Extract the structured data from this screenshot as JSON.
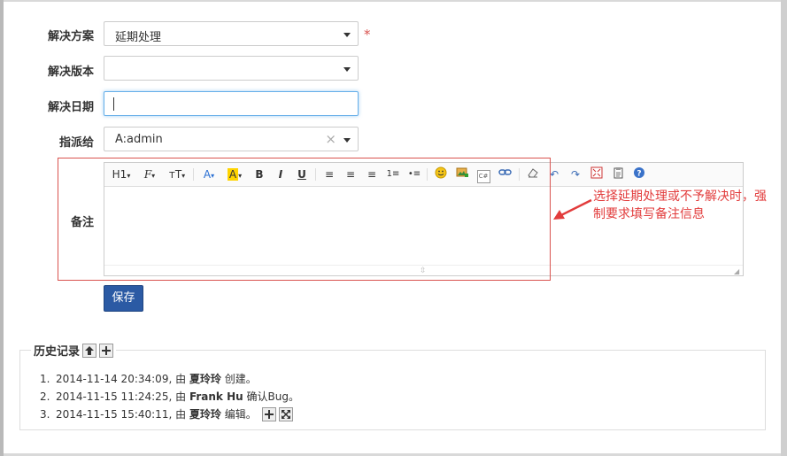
{
  "form": {
    "resolution_label": "解决方案",
    "resolution_value": "延期处理",
    "required_mark": "*",
    "version_label": "解决版本",
    "version_value": "",
    "date_label": "解决日期",
    "date_value": "",
    "assign_label": "指派给",
    "assign_value": "A:admin",
    "assign_clear": "×",
    "note_label": "备注",
    "save_label": "保存"
  },
  "toolbar": [
    "H1",
    "F",
    "тT",
    "A",
    "A",
    "B",
    "I",
    "U",
    "C#"
  ],
  "annotation": {
    "text": "选择延期处理或不予解决时，强制要求填写备注信息"
  },
  "history": {
    "title": "历史记录",
    "items": [
      {
        "num": "1.",
        "time": "2014-11-14 20:34:09,",
        "by": "由",
        "user": "夏玲玲",
        "action": "创建。"
      },
      {
        "num": "2.",
        "time": "2014-11-15 11:24:25,",
        "by": "由",
        "user": "Frank Hu",
        "action": "确认Bug。"
      },
      {
        "num": "3.",
        "time": "2014-11-15 15:40:11,",
        "by": "由",
        "user": "夏玲玲",
        "action": "编辑。"
      }
    ]
  },
  "colors": {
    "primary": "#2b5aa4",
    "annotation": "#e23c3c",
    "focus": "#66afe9"
  }
}
